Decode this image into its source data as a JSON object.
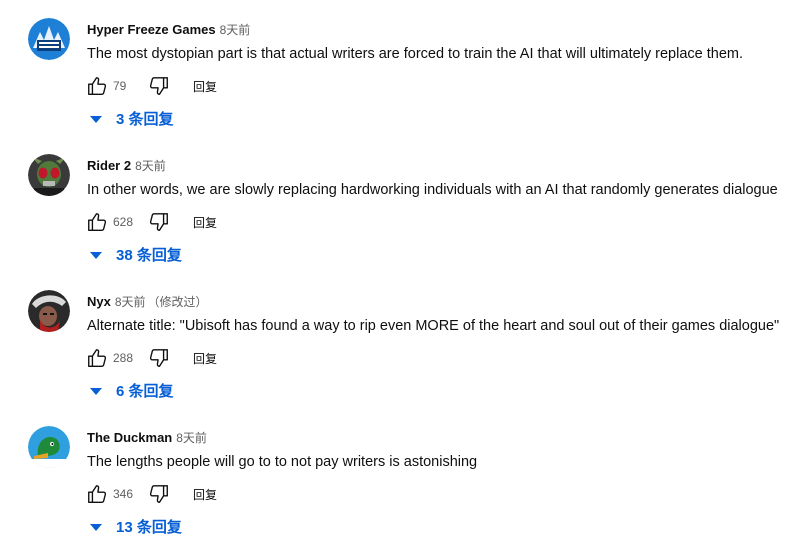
{
  "comments": [
    {
      "author": "Hyper Freeze Games",
      "time": "8天前",
      "edited": "",
      "text": "The most dystopian part is that actual writers are forced to train the AI that will ultimately replace them.",
      "likes": "79",
      "reply_label": "回复",
      "replies_label": "3 条回复",
      "avatar_icon": "hyper-freeze-logo",
      "avatar_color": "#1e7fd6"
    },
    {
      "author": "Rider 2",
      "time": "8天前",
      "edited": "",
      "text": "In other words, we are slowly replacing hardworking individuals with an AI that randomly generates dialogue",
      "likes": "628",
      "reply_label": "回复",
      "replies_label": "38 条回复",
      "avatar_icon": "masked-rider",
      "avatar_color": "#3a3a3a"
    },
    {
      "author": "Nyx",
      "time": "8天前",
      "edited": "（修改过）",
      "text": "Alternate title: \"Ubisoft has found a way to rip even MORE of the heart and soul out of their games dialogue\"",
      "likes": "288",
      "reply_label": "回复",
      "replies_label": "6 条回复",
      "avatar_icon": "dark-character",
      "avatar_color": "#2a2a2a"
    },
    {
      "author": "The Duckman",
      "time": "8天前",
      "edited": "",
      "text": "The lengths people will go to to not pay writers is astonishing",
      "likes": "346",
      "reply_label": "回复",
      "replies_label": "13 条回复",
      "avatar_icon": "duck-head",
      "avatar_color": "#2f9fe0"
    }
  ],
  "icons": {
    "like": "thumbs-up-icon",
    "dislike": "thumbs-down-icon",
    "expand": "caret-down-icon"
  },
  "colors": {
    "link": "#065fd4",
    "secondary_text": "#606060",
    "primary_text": "#0f0f0f"
  }
}
